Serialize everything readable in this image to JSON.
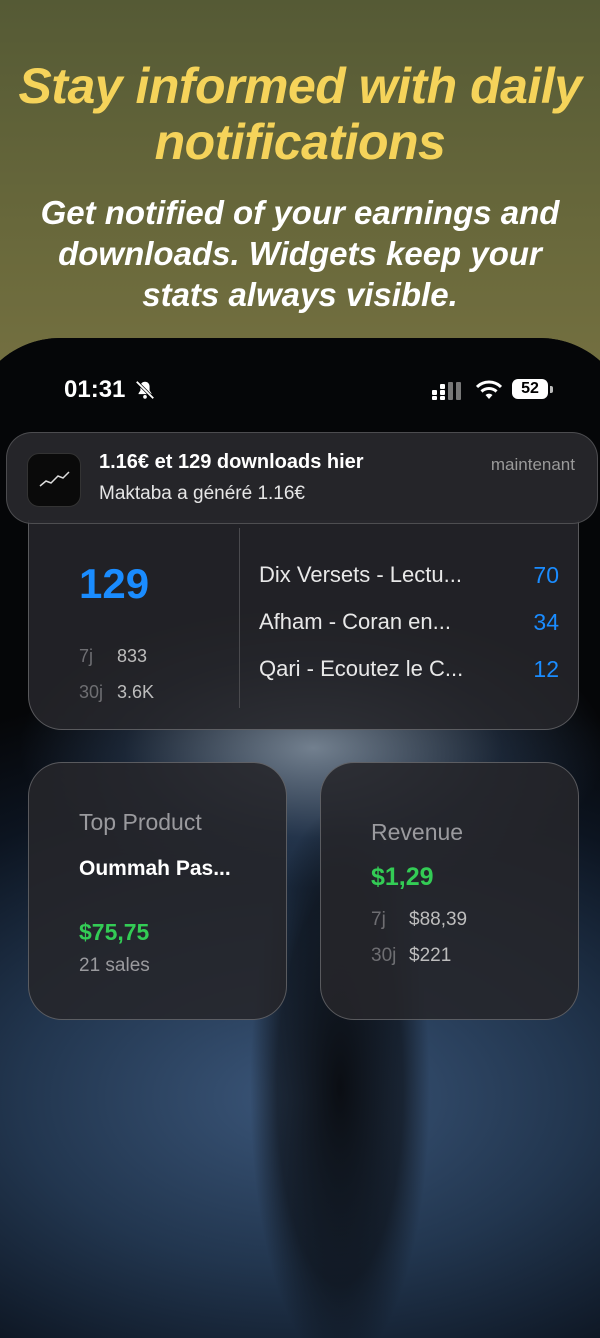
{
  "header": {
    "title": "Stay informed with daily notifications",
    "subtitle": "Get notified of your earnings and downloads. Widgets keep your stats always visible."
  },
  "status_bar": {
    "time": "01:31",
    "battery": "52",
    "icons": [
      "bell-slash-icon",
      "signal-icon",
      "wifi-icon",
      "battery-icon"
    ]
  },
  "notification": {
    "title": "1.16€ et 129 downloads hier",
    "body": "Maktaba a généré 1.16€",
    "time": "maintenant",
    "icon": "chart-line-icon"
  },
  "downloads_widget": {
    "total": "129",
    "stats": [
      {
        "key": "7j",
        "value": "833"
      },
      {
        "key": "30j",
        "value": "3.6K"
      }
    ],
    "apps": [
      {
        "name": "Dix Versets - Lectu...",
        "count": "70"
      },
      {
        "name": "Afham - Coran en...",
        "count": "34"
      },
      {
        "name": "Qari - Ecoutez le C...",
        "count": "12"
      }
    ],
    "accent": "#1a8cff"
  },
  "top_product_widget": {
    "label": "Top Product",
    "product": "Oummah Pas...",
    "amount": "$75,75",
    "sales": "21 sales"
  },
  "revenue_widget": {
    "label": "Revenue",
    "amount": "$1,29",
    "stats": [
      {
        "key": "7j",
        "value": "$88,39"
      },
      {
        "key": "30j",
        "value": "$221"
      }
    ],
    "accent": "#33cc55"
  }
}
